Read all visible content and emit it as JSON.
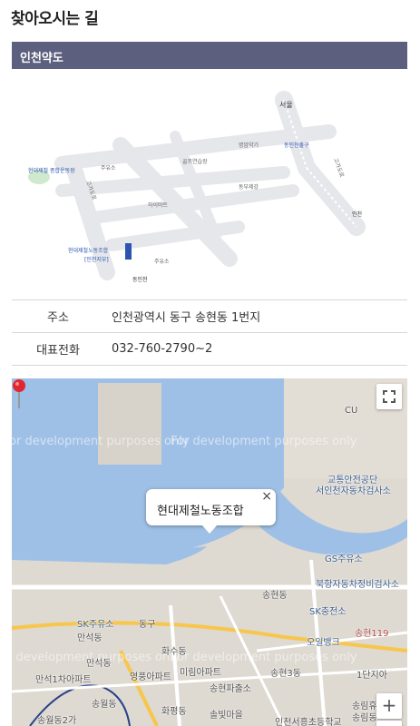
{
  "page": {
    "title": "찾아오시는 길"
  },
  "section": {
    "title": "인천약도"
  },
  "route_map": {
    "labels": {
      "seoul": "서울",
      "dongincheon_exit": "동인천출구",
      "golf": "골프연습장",
      "pharmacy": "명암약기",
      "gas1": "주유소",
      "gas2": "주유소",
      "hyundai_complex": "현대제철\n종합운동장",
      "himart": "하이마트",
      "dongbu": "동부제강",
      "union_a": "현대제철노동조합",
      "union_b": "[인천지부]",
      "dongincheon": "동인천",
      "incheon": "인천",
      "road1": "고가도로",
      "road2": "고가도로"
    }
  },
  "info": {
    "address_label": "주소",
    "address_value": "인천광역시 동구 송현동 1번지",
    "phone_label": "대표전화",
    "phone_value": "032-760-2790~2"
  },
  "map": {
    "watermark": "For development purposes only",
    "bubble_text": "현대제철노동조합",
    "close_symbol": "×",
    "zoom_in": "+",
    "zoom_out": "−",
    "places": {
      "cu": "CU",
      "traffic_a": "교통안전공단",
      "traffic_b": "서인천자동차검사소",
      "gs": "GS주유소",
      "bukhang": "북항자동차정비검사소",
      "songhyeon": "송현동",
      "sk_charge": "SK충전소",
      "songhyeon119": "송현119",
      "sk_gas": "SK주유소",
      "dong_gu": "동구",
      "manseok": "만석동",
      "ohwal": "오일뱅크",
      "hwasu": "화수동",
      "manseok2": "만석동",
      "manseok_apt": "만석1차아파트",
      "yeongpung": "영풍아파트",
      "mirim": "미림아파트",
      "songhyeon3": "송현3동",
      "songhyeon_market": "송현파출소",
      "danji": "1단지아",
      "songwol": "송월동",
      "hwapyeong": "화평동",
      "solbit": "솔빛마을",
      "seohung": "인천서흥초등학교",
      "songnim": "송림휴",
      "songnim_apt": "송림동",
      "songwol2": "송월동2가"
    }
  }
}
